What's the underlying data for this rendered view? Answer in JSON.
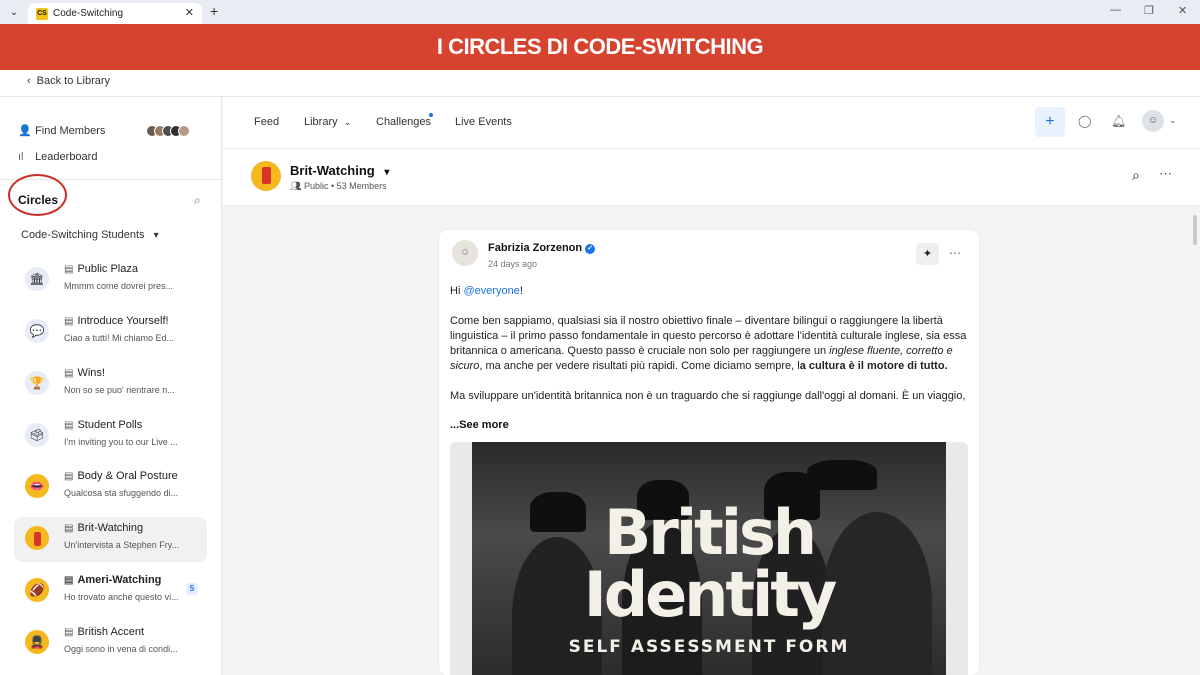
{
  "browser": {
    "tab_favicon": "CS",
    "tab_title": "Code-Switching",
    "tab_close": "✕",
    "new_tab": "+",
    "menu": "⌄",
    "win_min": "—",
    "win_max": "❐",
    "win_close": "✕"
  },
  "banner": {
    "title": "I CIRCLES DI CODE-SWITCHING",
    "color": "#d6432f"
  },
  "back": {
    "label": "Back to Library"
  },
  "sidebar": {
    "find_members": "Find Members",
    "leaderboard": "Leaderboard",
    "circles_title": "Circles",
    "group": "Code-Switching Students",
    "items": [
      {
        "name": "Public Plaza",
        "preview": "Mmmm come dovrei pres...",
        "icon": "bank-icon",
        "glyph": "🏛"
      },
      {
        "name": "Introduce Yourself!",
        "preview": "Ciao a tutti! Mi chiamo Ed...",
        "icon": "hello-bubble-icon",
        "glyph": "💬"
      },
      {
        "name": "Wins!",
        "preview": "Non so se puo' rientrare n...",
        "icon": "trophy-icon",
        "glyph": "🏆"
      },
      {
        "name": "Student Polls",
        "preview": "I'm inviting you to our Live ...",
        "icon": "poll-icon",
        "glyph": "🗳"
      },
      {
        "name": "Body & Oral Posture",
        "preview": "Qualcosa sta sfuggendo di...",
        "icon": "mouth-icon",
        "glyph": "👄"
      },
      {
        "name": "Brit-Watching",
        "preview": "Un'intervista a Stephen Fry...",
        "icon": "phone-booth-icon",
        "glyph": "▮"
      },
      {
        "name": "Ameri-Watching",
        "preview": "Ho trovato anche questo vi...",
        "icon": "football-icon",
        "glyph": "🏈",
        "badge": "5"
      },
      {
        "name": "British Accent",
        "preview": "Oggi sono in vena di condi...",
        "icon": "guards-icon",
        "glyph": "💂"
      }
    ]
  },
  "nav": {
    "feed": "Feed",
    "library": "Library",
    "challenges": "Challenges",
    "live_events": "Live Events",
    "plus": "+"
  },
  "circle": {
    "title": "Brit-Watching",
    "meta": "Public • 53 Members"
  },
  "post": {
    "author": "Fabrizia Zorzenon",
    "time": "24 days ago",
    "greeting": "Hi ",
    "mention": "@everyone",
    "greeting_end": "!",
    "p1_a": "Come ben sappiamo, qualsiasi sia il nostro obiettivo finale – diventare bilingui o raggiungere la libertà linguistica – il primo passo fondamentale in questo percorso è adottare l'identità culturale inglese, sia essa britannica o americana. Questo passo è cruciale non solo per raggiungere un ",
    "p1_em": "inglese fluente, corretto e sicuro",
    "p1_b": ", ma anche per vedere risultati più rapidi. Come diciamo sempre, l",
    "p1_strong": "a cultura è il motore di tutto.",
    "p2": "Ma sviluppare un'identità britannica non è un traguardo che si raggiunge dall'oggi al domani. È un viaggio, è un",
    "see_more": "...See more",
    "image_line1": "British",
    "image_line2": "Identity",
    "image_sub": "SELF ASSESSMENT FORM"
  }
}
